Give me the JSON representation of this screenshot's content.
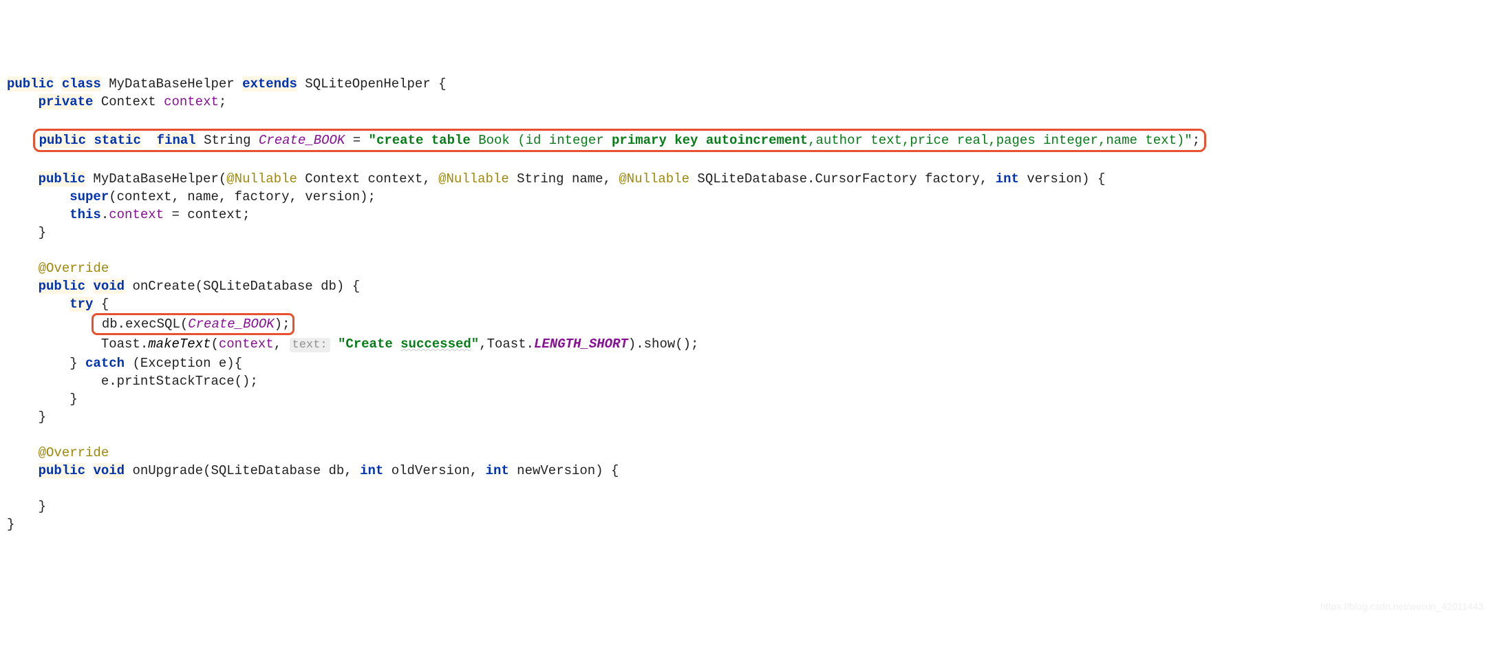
{
  "l1": {
    "a": "public",
    "b": "class",
    "c": " MyDataBaseHelper ",
    "d": "extends",
    "e": " SQLiteOpenHelper {"
  },
  "l2": {
    "a": "private",
    "b": " Context ",
    "c": "context",
    "d": ";"
  },
  "l3": {
    "a": "public",
    "b": "static",
    "c": "final",
    "d": " String ",
    "e": "Create_BOOK",
    "f": " = ",
    "g": "\"create table ",
    "h": "Book (id integer ",
    "i": "primary key autoincrement",
    "j": ",author text,price real,pages integer,name text)\"",
    "k": ";"
  },
  "l4": {
    "a": "public",
    "b": " MyDataBaseHelper(",
    "c": "@Nullable",
    "d": " Context context, ",
    "e": "@Nullable",
    "f": " String name, ",
    "g": "@Nullable",
    "h": " SQLiteDatabase.CursorFactory factory, ",
    "i": "int",
    "j": " version) {"
  },
  "l5": {
    "a": "super",
    "b": "(context, name, factory, version);"
  },
  "l6": {
    "a": "this",
    "b": ".",
    "c": "context",
    "d": " = context;"
  },
  "l7": {
    "a": "}"
  },
  "l8": {
    "a": "@Override"
  },
  "l9": {
    "a": "public",
    "b": "void",
    "c": " onCreate(SQLiteDatabase db) {"
  },
  "l10": {
    "a": "try",
    "b": " {"
  },
  "l11": {
    "a": "db.execSQL(",
    "b": "Create_BOOK",
    "c": ");"
  },
  "l12": {
    "a": "Toast.",
    "b": "makeText",
    "c": "(",
    "d": "context",
    "e": ", ",
    "f": "text:",
    "g": " ",
    "h": "\"Create ",
    "i": "successed",
    "j": "\"",
    "k": ",Toast.",
    "l": "LENGTH_SHORT",
    "m": ").show();"
  },
  "l13": {
    "a": "} ",
    "b": "catch",
    "c": " (Exception e){"
  },
  "l14": {
    "a": "e.printStackTrace();"
  },
  "l15": {
    "a": "}"
  },
  "l16": {
    "a": "}"
  },
  "l17": {
    "a": "@Override"
  },
  "l18": {
    "a": "public",
    "b": "void",
    "c": " onUpgrade(SQLiteDatabase db, ",
    "d": "int",
    "e": " oldVersion, ",
    "f": "int",
    "g": " newVersion) {"
  },
  "l19": {
    "a": "}"
  },
  "l20": {
    "a": "}"
  },
  "watermark": "https://blog.csdn.net/weixin_42011443"
}
